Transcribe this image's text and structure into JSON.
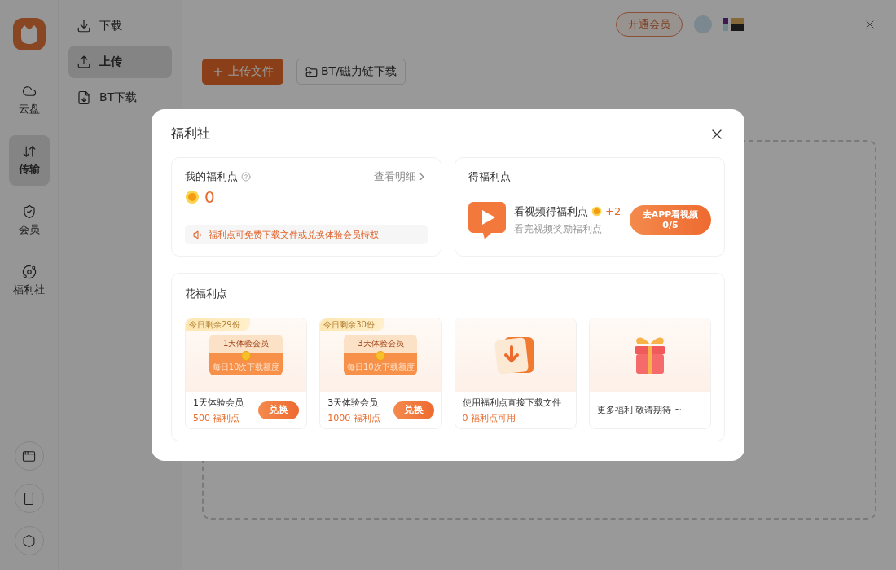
{
  "rail": {
    "items": [
      {
        "kind": "cloud",
        "label": "云盘",
        "selected": false
      },
      {
        "kind": "transfer",
        "label": "传输",
        "selected": true
      },
      {
        "kind": "member",
        "label": "会员",
        "selected": false
      },
      {
        "kind": "welfare",
        "label": "福利社",
        "selected": false
      }
    ]
  },
  "subnav": {
    "items": [
      {
        "kind": "download",
        "label": "下载",
        "selected": false
      },
      {
        "kind": "upload",
        "label": "上传",
        "selected": true
      },
      {
        "kind": "bt",
        "label": "BT下载",
        "selected": false
      }
    ]
  },
  "header": {
    "vip_button": "开通会员"
  },
  "toolbar": {
    "upload_button": "上传文件",
    "bt_button": "BT/磁力链下载"
  },
  "modal": {
    "title": "福利社",
    "my_points": {
      "title": "我的福利点",
      "link": "查看明细",
      "value": "0",
      "notice": "福利点可免费下载文件或兑换体验会员特权"
    },
    "earn": {
      "title": "得福利点",
      "task_title": "看视频得福利点",
      "reward": "+2",
      "task_desc": "看完视频奖励福利点",
      "button_line1": "去APP看视频",
      "button_line2": "0/5"
    },
    "spend": {
      "title": "花福利点",
      "items": [
        {
          "kind": "coupon",
          "badge": "今日剩余29份",
          "coupon_title": "1天体验会员",
          "coupon_note": "每日10次下载额度",
          "name": "1天体验会员",
          "price": "500 福利点",
          "button": "兑换"
        },
        {
          "kind": "coupon",
          "badge": "今日剩余30份",
          "coupon_title": "3天体验会员",
          "coupon_note": "每日10次下载额度",
          "name": "3天体验会员",
          "price": "1000 福利点",
          "button": "兑换"
        },
        {
          "kind": "download",
          "name": "使用福利点直接下载文件",
          "price": "0 福利点可用"
        },
        {
          "kind": "gift",
          "name": "更多福利 敬请期待 ~"
        }
      ]
    }
  }
}
